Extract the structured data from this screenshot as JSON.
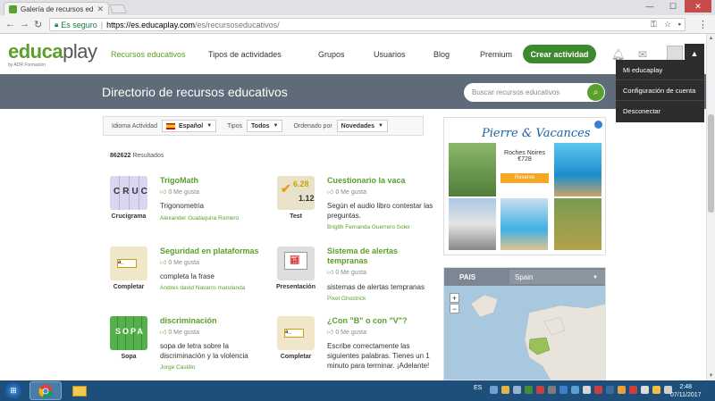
{
  "browser": {
    "tab_title": "Galería de recursos educ",
    "secure_label": "Es seguro",
    "url_host": "https://es.educaplay.com",
    "url_path": "/es/recursoseducativos/"
  },
  "site": {
    "logo_primary": "educa",
    "logo_secondary": "play",
    "logo_sub": "by ADR Formación",
    "nav": [
      "Recursos educativos",
      "Tipos de actividades",
      "Grupos",
      "Usuarios",
      "Blog",
      "Premium"
    ],
    "create_button": "Crear actividad",
    "user_menu": [
      "Mi educaplay",
      "Configuración de cuenta",
      "Desconectar"
    ]
  },
  "banner": {
    "title": "Directorio de recursos educativos",
    "search_placeholder": "Buscar recursos educativos"
  },
  "filters": {
    "language_label": "Idioma Actividad",
    "language_value": "Español",
    "type_label": "Tipos",
    "type_value": "Todos",
    "order_label": "Ordenado por",
    "order_value": "Novedades"
  },
  "results": {
    "count": "862622",
    "label": "Resultados"
  },
  "cards": [
    {
      "title": "TrigoMath",
      "likes": "0 Me gusta",
      "desc": "Trigonometria",
      "author": "Alexander Guataquira Romero",
      "type": "Crucigrama"
    },
    {
      "title": "Cuestionario la vaca",
      "likes": "0 Me gusta",
      "desc": "Según el audio libro contestar las preguntas.",
      "author": "Brigith Fernanda Guerrero Soler",
      "type": "Test"
    },
    {
      "title": "Seguridad en plataformas",
      "likes": "0 Me gusta",
      "desc": "completa la frase",
      "author": "Andres david Navarro marulanda",
      "type": "Completar"
    },
    {
      "title": "Sistema de alertas tempranas",
      "likes": "0 Me gusta",
      "desc": "sistemas de alertas tempranas",
      "author": "Pixel Ghostrick",
      "type": "Presentación"
    },
    {
      "title": "discriminación",
      "likes": "0 Me gusta",
      "desc": "sopa de letra sobre la discriminación y la violencia",
      "author": "Jorge Castillo",
      "type": "Sopa"
    },
    {
      "title": "¿Con \"B\" o con \"V\"?",
      "likes": "0 Me gusta",
      "desc": "Escribe correctamente las siguientes palabras. Tienes un 1 minuto para terminar. ¡Adelante!",
      "author": "",
      "type": "Completar"
    }
  ],
  "ad": {
    "brand": "Pierre & Vacances",
    "hotel": "Roches Noires",
    "price": "€728",
    "button": "Reserve"
  },
  "map": {
    "label": "PAIS",
    "country": "Spain"
  },
  "taskbar": {
    "lang": "ES",
    "time": "2:48",
    "date": "07/11/2017"
  }
}
